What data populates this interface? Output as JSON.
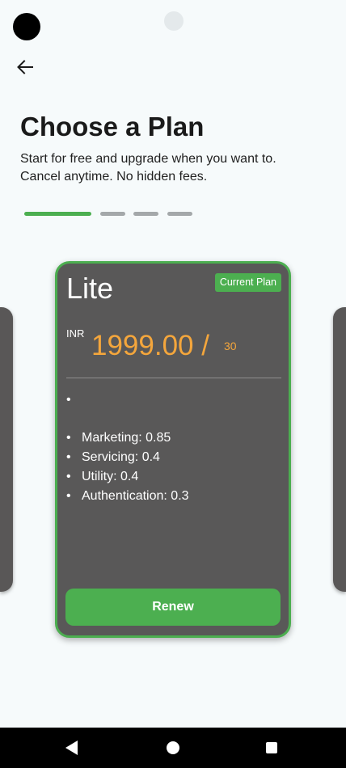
{
  "header": {
    "title": "Choose a Plan",
    "subtitle_lines": [
      "Start for free and upgrade when you want to.",
      "Cancel anytime. No hidden fees."
    ]
  },
  "pager": {
    "count": 4,
    "active_index": 0,
    "active_color": "#4caf50",
    "inactive_color": "#a4a8aa"
  },
  "plan": {
    "name": "Lite",
    "badge": "Current Plan",
    "currency": "INR",
    "price": "1999.00 /",
    "period": "30",
    "empty_bullet": "•",
    "features": [
      "Marketing: 0.85",
      "Servicing: 0.4",
      "Utility: 0.4",
      "Authentication: 0.3"
    ],
    "action_label": "Renew"
  },
  "colors": {
    "accent": "#4caf50",
    "price": "#f4a63c",
    "card_background": "#595858"
  },
  "icons": {
    "back": "arrow-left-icon",
    "nav_back": "triangle-back-icon",
    "nav_home": "circle-home-icon",
    "nav_recents": "square-recents-icon"
  }
}
